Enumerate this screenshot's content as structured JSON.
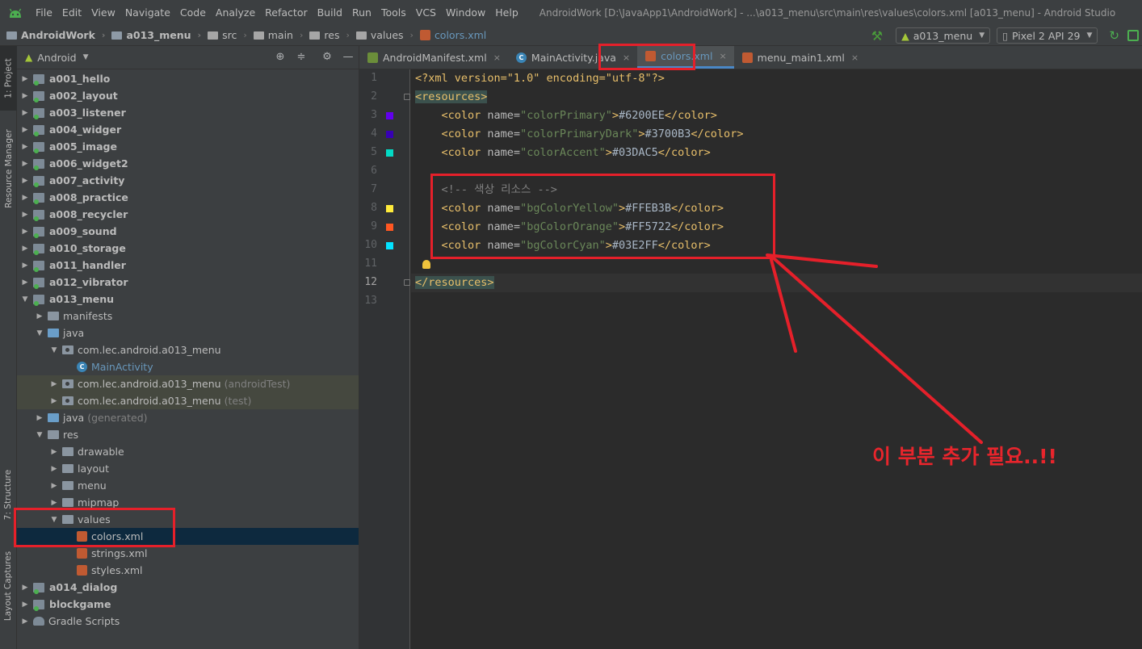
{
  "menubar": {
    "items": [
      "File",
      "Edit",
      "View",
      "Navigate",
      "Code",
      "Analyze",
      "Refactor",
      "Build",
      "Run",
      "Tools",
      "VCS",
      "Window",
      "Help"
    ],
    "window_title": "AndroidWork [D:\\JavaApp1\\AndroidWork] - ...\\a013_menu\\src\\main\\res\\values\\colors.xml [a013_menu] - Android Studio"
  },
  "breadcrumb": [
    "AndroidWork",
    "a013_menu",
    "src",
    "main",
    "res",
    "values",
    "colors.xml"
  ],
  "toolbar": {
    "run_config": "a013_menu",
    "device": "Pixel 2 API 29"
  },
  "left_strip": {
    "project": "1: Project",
    "resource_manager": "Resource Manager",
    "structure": "7: Structure",
    "layout_captures": "Layout Captures"
  },
  "project_panel": {
    "view_mode": "Android",
    "tree": [
      {
        "label": "a001_hello",
        "type": "module",
        "depth": 0,
        "expanded": false
      },
      {
        "label": "a002_layout",
        "type": "module",
        "depth": 0,
        "expanded": false
      },
      {
        "label": "a003_listener",
        "type": "module",
        "depth": 0,
        "expanded": false
      },
      {
        "label": "a004_widger",
        "type": "module",
        "depth": 0,
        "expanded": false
      },
      {
        "label": "a005_image",
        "type": "module",
        "depth": 0,
        "expanded": false
      },
      {
        "label": "a006_widget2",
        "type": "module",
        "depth": 0,
        "expanded": false
      },
      {
        "label": "a007_activity",
        "type": "module",
        "depth": 0,
        "expanded": false
      },
      {
        "label": "a008_practice",
        "type": "module",
        "depth": 0,
        "expanded": false
      },
      {
        "label": "a008_recycler",
        "type": "module",
        "depth": 0,
        "expanded": false
      },
      {
        "label": "a009_sound",
        "type": "module",
        "depth": 0,
        "expanded": false
      },
      {
        "label": "a010_storage",
        "type": "module",
        "depth": 0,
        "expanded": false
      },
      {
        "label": "a011_handler",
        "type": "module",
        "depth": 0,
        "expanded": false
      },
      {
        "label": "a012_vibrator",
        "type": "module",
        "depth": 0,
        "expanded": false
      },
      {
        "label": "a013_menu",
        "type": "module",
        "depth": 0,
        "expanded": true
      },
      {
        "label": "manifests",
        "type": "folder",
        "depth": 1,
        "expanded": false
      },
      {
        "label": "java",
        "type": "folder-blue",
        "depth": 1,
        "expanded": true
      },
      {
        "label": "com.lec.android.a013_menu",
        "type": "package",
        "depth": 2,
        "expanded": true
      },
      {
        "label": "MainActivity",
        "type": "class",
        "depth": 3,
        "leaf": true
      },
      {
        "label": "com.lec.android.a013_menu",
        "suffix": "(androidTest)",
        "type": "package",
        "depth": 2,
        "expanded": false,
        "highlight": true
      },
      {
        "label": "com.lec.android.a013_menu",
        "suffix": "(test)",
        "type": "package",
        "depth": 2,
        "expanded": false,
        "highlight": true
      },
      {
        "label": "java",
        "suffix": "(generated)",
        "type": "folder-blue",
        "depth": 1,
        "expanded": false
      },
      {
        "label": "res",
        "type": "folder",
        "depth": 1,
        "expanded": true
      },
      {
        "label": "drawable",
        "type": "folder",
        "depth": 2,
        "expanded": false
      },
      {
        "label": "layout",
        "type": "folder",
        "depth": 2,
        "expanded": false
      },
      {
        "label": "menu",
        "type": "folder",
        "depth": 2,
        "expanded": false
      },
      {
        "label": "mipmap",
        "type": "folder",
        "depth": 2,
        "expanded": false
      },
      {
        "label": "values",
        "type": "folder",
        "depth": 2,
        "expanded": true
      },
      {
        "label": "colors.xml",
        "type": "xml",
        "depth": 3,
        "leaf": true,
        "selected": true
      },
      {
        "label": "strings.xml",
        "type": "xml",
        "depth": 3,
        "leaf": true
      },
      {
        "label": "styles.xml",
        "type": "xml",
        "depth": 3,
        "leaf": true
      },
      {
        "label": "a014_dialog",
        "type": "module",
        "depth": 0,
        "expanded": false
      },
      {
        "label": "blockgame",
        "type": "module",
        "depth": 0,
        "expanded": false
      },
      {
        "label": "Gradle Scripts",
        "type": "gradle",
        "depth": 0,
        "expanded": false
      }
    ]
  },
  "editor_tabs": [
    {
      "label": "AndroidManifest.xml",
      "icon": "manifest-icon",
      "active": false
    },
    {
      "label": "MainActivity.java",
      "icon": "java-class-icon",
      "active": false
    },
    {
      "label": "colors.xml",
      "icon": "xml-icon",
      "active": true
    },
    {
      "label": "menu_main1.xml",
      "icon": "xml-icon",
      "active": false
    }
  ],
  "editor": {
    "current_line": 12,
    "lines": [
      {
        "n": "1",
        "tokens": [
          [
            "pi",
            "<?xml version=\"1.0\" encoding=\"utf-8\"?>"
          ]
        ]
      },
      {
        "n": "2",
        "tokens": [
          [
            "tag",
            "<resources>"
          ]
        ]
      },
      {
        "n": "3",
        "swatch": "#6200EE",
        "tokens": [
          [
            "text",
            "    "
          ],
          [
            "tag",
            "<color "
          ],
          [
            "attr",
            "name="
          ],
          [
            "val",
            "\"colorPrimary\""
          ],
          [
            "tag",
            ">"
          ],
          [
            "text",
            "#6200EE"
          ],
          [
            "tag",
            "</color>"
          ]
        ]
      },
      {
        "n": "4",
        "swatch": "#3700B3",
        "tokens": [
          [
            "text",
            "    "
          ],
          [
            "tag",
            "<color "
          ],
          [
            "attr",
            "name="
          ],
          [
            "val",
            "\"colorPrimaryDark\""
          ],
          [
            "tag",
            ">"
          ],
          [
            "text",
            "#3700B3"
          ],
          [
            "tag",
            "</color>"
          ]
        ]
      },
      {
        "n": "5",
        "swatch": "#03DAC5",
        "tokens": [
          [
            "text",
            "    "
          ],
          [
            "tag",
            "<color "
          ],
          [
            "attr",
            "name="
          ],
          [
            "val",
            "\"colorAccent\""
          ],
          [
            "tag",
            ">"
          ],
          [
            "text",
            "#03DAC5"
          ],
          [
            "tag",
            "</color>"
          ]
        ]
      },
      {
        "n": "6",
        "tokens": []
      },
      {
        "n": "7",
        "tokens": [
          [
            "text",
            "    "
          ],
          [
            "com",
            "<!-- 색상 리소스 -->"
          ]
        ]
      },
      {
        "n": "8",
        "swatch": "#FFEB3B",
        "tokens": [
          [
            "text",
            "    "
          ],
          [
            "tag",
            "<color "
          ],
          [
            "attr",
            "name="
          ],
          [
            "val",
            "\"bgColorYellow\""
          ],
          [
            "tag",
            ">"
          ],
          [
            "text",
            "#FFEB3B"
          ],
          [
            "tag",
            "</color>"
          ]
        ]
      },
      {
        "n": "9",
        "swatch": "#FF5722",
        "tokens": [
          [
            "text",
            "    "
          ],
          [
            "tag",
            "<color "
          ],
          [
            "attr",
            "name="
          ],
          [
            "val",
            "\"bgColorOrange\""
          ],
          [
            "tag",
            ">"
          ],
          [
            "text",
            "#FF5722"
          ],
          [
            "tag",
            "</color>"
          ]
        ]
      },
      {
        "n": "10",
        "swatch": "#03E2FF",
        "tokens": [
          [
            "text",
            "    "
          ],
          [
            "tag",
            "<color "
          ],
          [
            "attr",
            "name="
          ],
          [
            "val",
            "\"bgColorCyan\""
          ],
          [
            "tag",
            ">"
          ],
          [
            "text",
            "#03E2FF"
          ],
          [
            "tag",
            "</color>"
          ]
        ]
      },
      {
        "n": "11",
        "tokens": []
      },
      {
        "n": "12",
        "tokens": [
          [
            "tag",
            "</resources>"
          ]
        ]
      },
      {
        "n": "13",
        "tokens": []
      }
    ]
  },
  "annotation": {
    "text": "이 부분 추가 필요..!!",
    "color": "#E5202A"
  }
}
